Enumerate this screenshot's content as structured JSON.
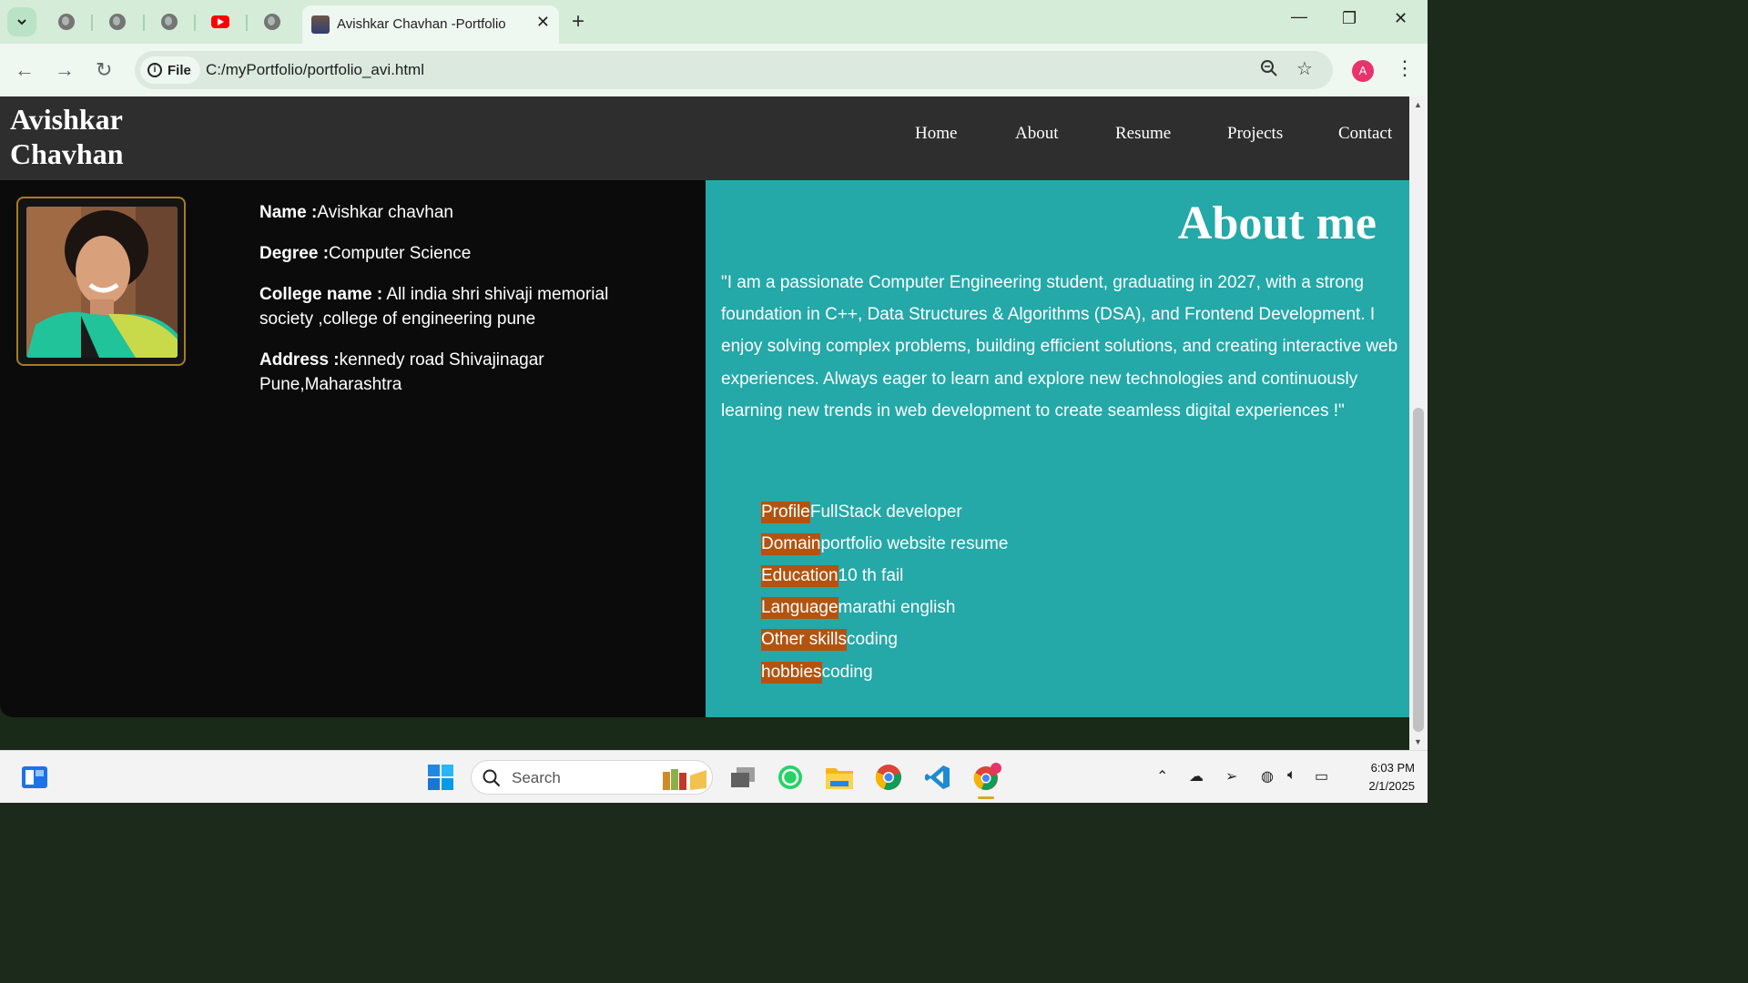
{
  "browser": {
    "active_tab_title": "Avishkar Chavhan -Portfolio",
    "file_chip": "File",
    "url": "C:/myPortfolio/portfolio_avi.html",
    "profile_initial": "A"
  },
  "site": {
    "brand_line1": "Avishkar",
    "brand_line2": "Chavhan",
    "nav": [
      "Home",
      "About",
      "Resume",
      "Projects",
      "Contact"
    ]
  },
  "personal": {
    "name_label": "Name :",
    "name_value": "Avishkar chavhan",
    "degree_label": "Degree :",
    "degree_value": "Computer Science",
    "college_label": "College name :",
    "college_value": " All india shri shivaji memorial society ,college of engineering pune",
    "address_label": "Address :",
    "address_value": "kennedy road Shivajinagar Pune,Maharashtra"
  },
  "about": {
    "title": "About me",
    "text": "\"I am a passionate Computer Engineering student, graduating in 2027, with a strong foundation in C++, Data Structures & Algorithms (DSA), and Frontend Development. I enjoy solving complex problems, building efficient solutions, and creating interactive web experiences. Always eager to learn and explore new technologies and continuously learning new trends in web development to create seamless digital experiences !\"",
    "facts": [
      {
        "label": "Profile",
        "value": "FullStack developer"
      },
      {
        "label": "Domain",
        "value": "portfolio website resume"
      },
      {
        "label": "Education",
        "value": "10 th fail"
      },
      {
        "label": "Language",
        "value": "marathi english"
      },
      {
        "label": "Other skills",
        "value": "coding"
      },
      {
        "label": "hobbies",
        "value": "coding"
      }
    ]
  },
  "taskbar": {
    "search_placeholder": "Search",
    "time": "6:03 PM",
    "date": "2/1/2025"
  },
  "colors": {
    "header_bg": "#2e2e2e",
    "left_panel_bg": "#0b0b0b",
    "right_panel_bg": "#24a8a8",
    "fact_label_bg": "#b25410",
    "photo_border": "#a67d1e"
  }
}
